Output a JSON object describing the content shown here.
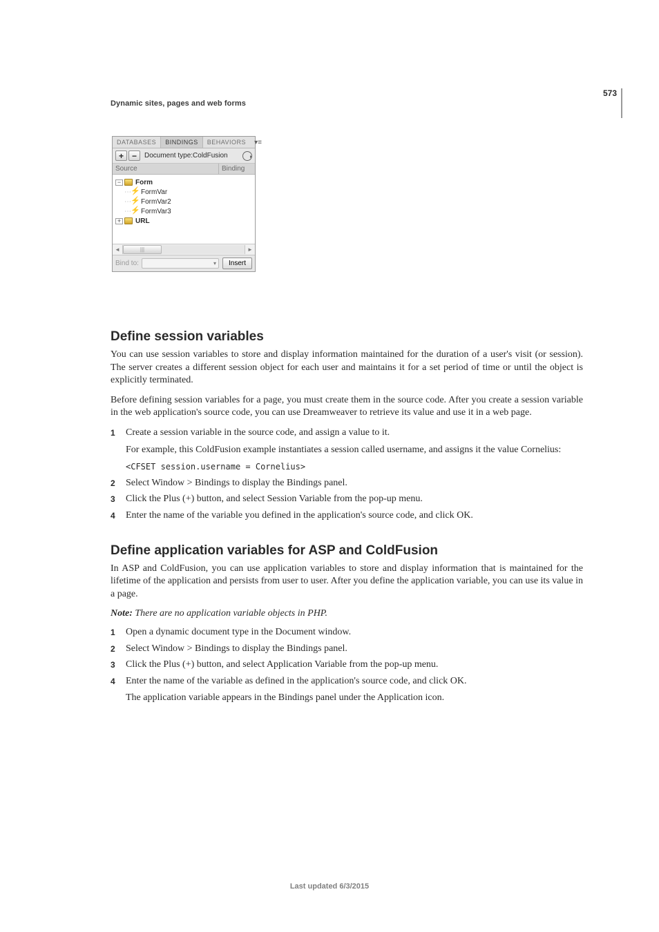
{
  "page_number": "573",
  "running_head": "Dynamic sites, pages and web forms",
  "panel": {
    "tabs": {
      "database": "DATABASES",
      "bindings": "BINDINGS",
      "behaviors": "BEHAVIORS"
    },
    "toolbar": {
      "plus": "+",
      "minus": "−",
      "doc_type_label": "Document type:ColdFusion"
    },
    "columns": {
      "source": "Source",
      "binding": "Binding"
    },
    "tree": {
      "form_label": "Form",
      "items": [
        "FormVar",
        "FormVar2",
        "FormVar3"
      ],
      "url_label": "URL"
    },
    "footer": {
      "bindto": "Bind to:",
      "insert": "Insert"
    }
  },
  "section1": {
    "heading": "Define session variables",
    "para1": "You can use session variables to store and display information maintained for the duration of a user's visit (or session). The server creates a different session object for each user and maintains it for a set period of time or until the object is explicitly terminated.",
    "para2": "Before defining session variables for a page, you must create them in the source code. After you create a session variable in the web application's source code, you can use Dreamweaver to retrieve its value and use it in a web page.",
    "steps": [
      {
        "num": "1",
        "text": "Create a session variable in the source code, and assign a value to it.",
        "sub": "For example, this ColdFusion example instantiates a session called username, and assigns it the value Cornelius:",
        "code": "<CFSET session.username = Cornelius>"
      },
      {
        "num": "2",
        "text": "Select Window > Bindings to display the Bindings panel."
      },
      {
        "num": "3",
        "text": "Click the Plus (+) button, and select Session Variable from the pop-up menu."
      },
      {
        "num": "4",
        "text": "Enter the name of the variable you defined in the application's source code, and click OK."
      }
    ]
  },
  "section2": {
    "heading": "Define application variables for ASP and ColdFusion",
    "para1": "In ASP and ColdFusion, you can use application variables to store and display information that is maintained for the lifetime of the application and persists from user to user. After you define the application variable, you can use its value in a page.",
    "note_label": "Note:",
    "note_body": " There are no application variable objects in PHP.",
    "steps": [
      {
        "num": "1",
        "text": "Open a dynamic document type in the Document window."
      },
      {
        "num": "2",
        "text": "Select Window > Bindings to display the Bindings panel."
      },
      {
        "num": "3",
        "text": "Click the Plus (+) button, and select Application Variable from the pop-up menu."
      },
      {
        "num": "4",
        "text": "Enter the name of the variable as defined in the application's source code, and click OK.",
        "sub": "The application variable appears in the Bindings panel under the Application icon."
      }
    ]
  },
  "footer_updated": "Last updated 6/3/2015"
}
